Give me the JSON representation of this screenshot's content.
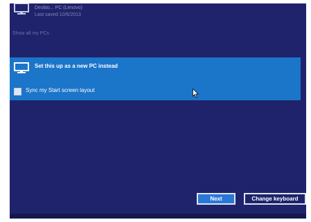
{
  "existing_pc": {
    "name": "Deskto... PC (Lenovo)",
    "last_saved": "Last saved 10/6/2013"
  },
  "show_all_link": "Show all my PCs",
  "new_pc_tile": {
    "title": "Set this up as a new PC instead",
    "sync_checkbox": {
      "label": "Sync my Start screen layout",
      "checked": false
    }
  },
  "buttons": {
    "next": "Next",
    "change_keyboard": "Change keyboard"
  },
  "icons": {
    "pc": "monitor-icon",
    "cursor": "mouse-pointer-icon"
  },
  "colors": {
    "background": "#1e236b",
    "tile_selected": "#1b75c9",
    "button_primary": "#2b77d6",
    "text": "#ffffff"
  }
}
